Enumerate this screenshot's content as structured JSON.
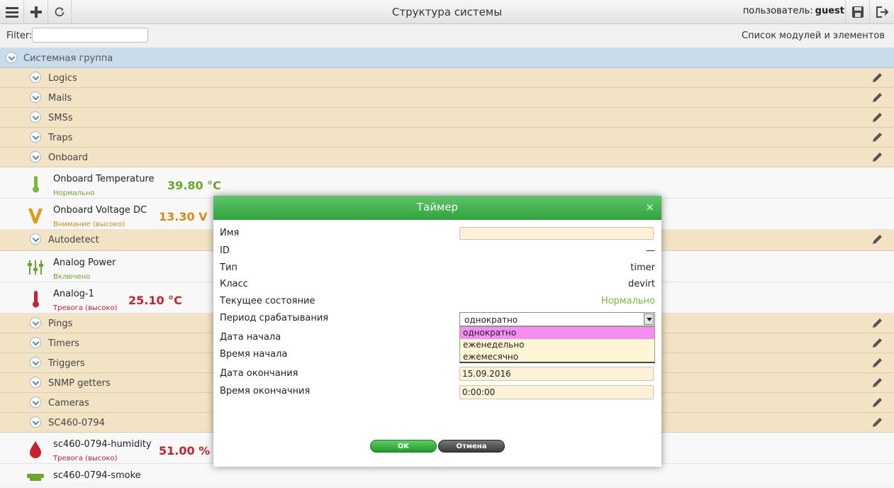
{
  "header": {
    "title": "Структура системы",
    "user_label": "пользователь:",
    "user_name": "guest"
  },
  "filterbar": {
    "filter_label": "Filter:",
    "filter_value": "",
    "modules_link": "Список модулей и элементов"
  },
  "tree": {
    "system_group": "Системная группа",
    "groups": {
      "logics": "Logics",
      "mails": "Mails",
      "smss": "SMSs",
      "traps": "Traps",
      "onboard": "Onboard",
      "autodetect": "Autodetect",
      "pings": "Pings",
      "timers": "Timers",
      "triggers": "Triggers",
      "snmp": "SNMP getters",
      "cameras": "Cameras",
      "sc460": "SC460-0794"
    },
    "items": {
      "temp": {
        "name": "Onboard Temperature",
        "status": "Нормально",
        "value": "39.80 °C"
      },
      "voltage": {
        "name": "Onboard Voltage DC",
        "status": "Внимание (высоко)",
        "value": "13.30 V"
      },
      "power": {
        "name": "Analog Power",
        "status": "Включено"
      },
      "analog1": {
        "name": "Analog-1",
        "status": "Тревога (высоко)",
        "value": "25.10 °C"
      },
      "humidity": {
        "name": "sc460-0794-humidity",
        "status": "Тревога (высоко)",
        "value": "51.00 %"
      },
      "smoke": {
        "name": "sc460-0794-smoke"
      }
    },
    "colors": {
      "ok": "#6aa72a",
      "warn": "#d98a12",
      "alarm": "#c8232c"
    }
  },
  "dialog": {
    "title": "Таймер",
    "close_glyph": "×",
    "fields": {
      "name_label": "Имя",
      "name_value": "",
      "id_label": "ID",
      "id_value": "—",
      "type_label": "Тип",
      "type_value": "timer",
      "class_label": "Класс",
      "class_value": "devirt",
      "state_label": "Текущее состояние",
      "state_value": "Нормально",
      "period_label": "Период срабатывания",
      "period_value": "однократно",
      "start_date_label": "Дата начала",
      "start_time_label": "Время начала",
      "end_date_label": "Дата окончания",
      "end_date_value": "15.09.2016",
      "end_time_label": "Время окончачния",
      "end_time_value": "0:00:00"
    },
    "period_options": [
      "однократно",
      "еженедельно",
      "ежемесячно"
    ],
    "ok_label": "OK",
    "cancel_label": "Отмена"
  }
}
